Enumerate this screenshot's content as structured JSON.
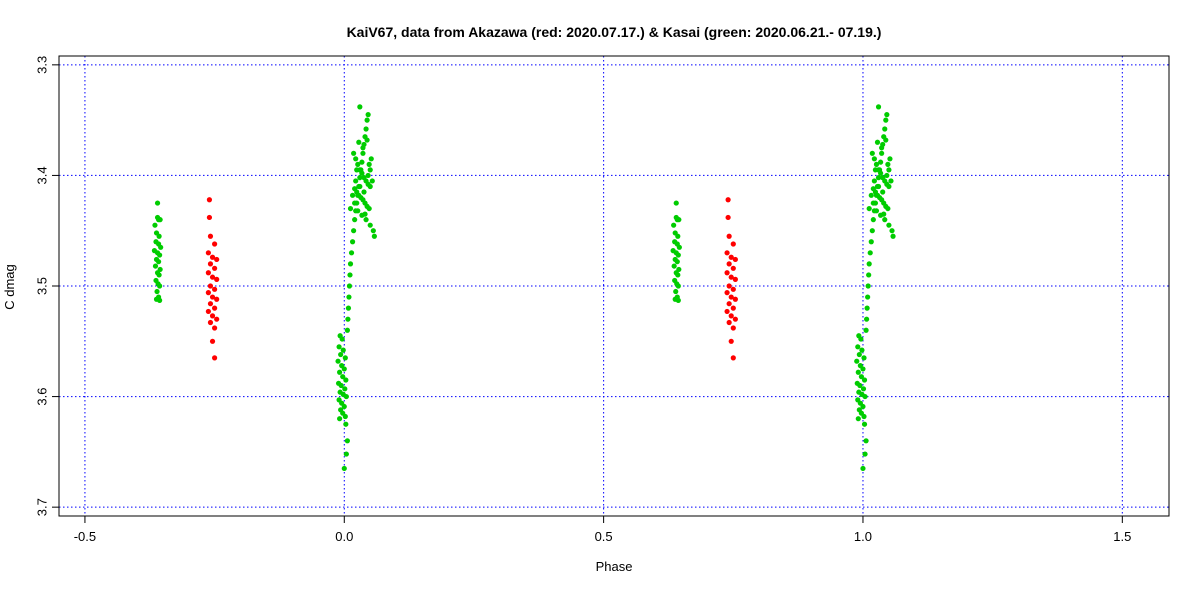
{
  "chart_data": {
    "type": "scatter",
    "title": "KaiV67, data from Akazawa (red: 2020.07.17.) &  Kasai (green: 2020.06.21.- 07.19.)",
    "xlabel": "Phase",
    "ylabel": "C dmag",
    "xlim": [
      -0.55,
      1.59
    ],
    "ylim": [
      3.708,
      3.292
    ],
    "y_inverted": true,
    "grid": true,
    "grid_color": "#0000ff",
    "legend": "none",
    "x_ticks": [
      {
        "value": -0.5,
        "label": "-0.5"
      },
      {
        "value": 0.0,
        "label": "0.0"
      },
      {
        "value": 0.5,
        "label": "0.5"
      },
      {
        "value": 1.0,
        "label": "1.0"
      },
      {
        "value": 1.5,
        "label": "1.5"
      }
    ],
    "y_ticks": [
      {
        "value": 3.3,
        "label": "3.3"
      },
      {
        "value": 3.4,
        "label": "3.4"
      },
      {
        "value": 3.5,
        "label": "3.5"
      },
      {
        "value": 3.6,
        "label": "3.6"
      },
      {
        "value": 3.7,
        "label": "3.7"
      }
    ],
    "series": [
      {
        "color": "#00cc00",
        "points": [
          [
            -0.36,
            3.425
          ],
          [
            -0.36,
            3.438
          ],
          [
            -0.358,
            3.44
          ],
          [
            -0.355,
            3.44
          ],
          [
            -0.365,
            3.445
          ],
          [
            -0.362,
            3.452
          ],
          [
            -0.357,
            3.455
          ],
          [
            -0.363,
            3.46
          ],
          [
            -0.358,
            3.462
          ],
          [
            -0.354,
            3.465
          ],
          [
            -0.366,
            3.468
          ],
          [
            -0.36,
            3.47
          ],
          [
            -0.356,
            3.472
          ],
          [
            -0.362,
            3.476
          ],
          [
            -0.358,
            3.478
          ],
          [
            -0.364,
            3.482
          ],
          [
            -0.355,
            3.485
          ],
          [
            -0.36,
            3.488
          ],
          [
            -0.357,
            3.49
          ],
          [
            -0.363,
            3.495
          ],
          [
            -0.359,
            3.498
          ],
          [
            -0.356,
            3.5
          ],
          [
            -0.361,
            3.505
          ],
          [
            -0.358,
            3.51
          ],
          [
            -0.362,
            3.512
          ],
          [
            -0.356,
            3.513
          ],
          [
            -0.008,
            3.545
          ],
          [
            -0.004,
            3.548
          ],
          [
            -0.01,
            3.555
          ],
          [
            -0.002,
            3.558
          ],
          [
            -0.007,
            3.562
          ],
          [
            0.002,
            3.565
          ],
          [
            -0.012,
            3.568
          ],
          [
            -0.005,
            3.572
          ],
          [
            0.0,
            3.575
          ],
          [
            -0.009,
            3.578
          ],
          [
            -0.003,
            3.582
          ],
          [
            0.003,
            3.585
          ],
          [
            -0.011,
            3.588
          ],
          [
            -0.006,
            3.59
          ],
          [
            0.001,
            3.593
          ],
          [
            -0.008,
            3.596
          ],
          [
            -0.002,
            3.598
          ],
          [
            0.004,
            3.6
          ],
          [
            -0.01,
            3.603
          ],
          [
            -0.005,
            3.606
          ],
          [
            0.0,
            3.609
          ],
          [
            -0.007,
            3.612
          ],
          [
            -0.003,
            3.615
          ],
          [
            0.002,
            3.618
          ],
          [
            -0.009,
            3.62
          ],
          [
            0.003,
            3.625
          ],
          [
            0.006,
            3.64
          ],
          [
            0.004,
            3.652
          ],
          [
            0.0,
            3.665
          ],
          [
            0.006,
            3.54
          ],
          [
            0.007,
            3.53
          ],
          [
            0.008,
            3.52
          ],
          [
            0.009,
            3.51
          ],
          [
            0.01,
            3.5
          ],
          [
            0.011,
            3.49
          ],
          [
            0.012,
            3.48
          ],
          [
            0.014,
            3.47
          ],
          [
            0.016,
            3.46
          ],
          [
            0.018,
            3.45
          ],
          [
            0.02,
            3.44
          ],
          [
            0.022,
            3.432
          ],
          [
            0.024,
            3.425
          ],
          [
            0.026,
            3.418
          ],
          [
            0.028,
            3.41
          ],
          [
            0.03,
            3.402
          ],
          [
            0.032,
            3.395
          ],
          [
            0.034,
            3.388
          ],
          [
            0.036,
            3.38
          ],
          [
            0.038,
            3.372
          ],
          [
            0.04,
            3.365
          ],
          [
            0.042,
            3.358
          ],
          [
            0.044,
            3.35
          ],
          [
            0.046,
            3.345
          ],
          [
            0.03,
            3.338
          ],
          [
            0.018,
            3.38
          ],
          [
            0.022,
            3.385
          ],
          [
            0.026,
            3.39
          ],
          [
            0.03,
            3.395
          ],
          [
            0.034,
            3.398
          ],
          [
            0.038,
            3.402
          ],
          [
            0.042,
            3.405
          ],
          [
            0.046,
            3.408
          ],
          [
            0.05,
            3.41
          ],
          [
            0.02,
            3.412
          ],
          [
            0.024,
            3.415
          ],
          [
            0.028,
            3.418
          ],
          [
            0.032,
            3.42
          ],
          [
            0.036,
            3.422
          ],
          [
            0.04,
            3.425
          ],
          [
            0.044,
            3.428
          ],
          [
            0.048,
            3.43
          ],
          [
            0.022,
            3.405
          ],
          [
            0.03,
            3.41
          ],
          [
            0.038,
            3.415
          ],
          [
            0.046,
            3.4
          ],
          [
            0.05,
            3.395
          ],
          [
            0.054,
            3.405
          ],
          [
            0.026,
            3.432
          ],
          [
            0.034,
            3.436
          ],
          [
            0.042,
            3.44
          ],
          [
            0.05,
            3.445
          ],
          [
            0.056,
            3.45
          ],
          [
            0.058,
            3.455
          ],
          [
            0.028,
            3.37
          ],
          [
            0.036,
            3.375
          ],
          [
            0.044,
            3.368
          ],
          [
            0.052,
            3.385
          ],
          [
            0.048,
            3.39
          ],
          [
            0.024,
            3.395
          ],
          [
            0.016,
            3.418
          ],
          [
            0.02,
            3.425
          ],
          [
            0.012,
            3.43
          ],
          [
            0.04,
            3.435
          ],
          [
            0.64,
            3.425
          ],
          [
            0.64,
            3.438
          ],
          [
            0.642,
            3.44
          ],
          [
            0.645,
            3.44
          ],
          [
            0.635,
            3.445
          ],
          [
            0.638,
            3.452
          ],
          [
            0.643,
            3.455
          ],
          [
            0.637,
            3.46
          ],
          [
            0.642,
            3.462
          ],
          [
            0.646,
            3.465
          ],
          [
            0.634,
            3.468
          ],
          [
            0.64,
            3.47
          ],
          [
            0.644,
            3.472
          ],
          [
            0.638,
            3.476
          ],
          [
            0.642,
            3.478
          ],
          [
            0.636,
            3.482
          ],
          [
            0.645,
            3.485
          ],
          [
            0.64,
            3.488
          ],
          [
            0.643,
            3.49
          ],
          [
            0.637,
            3.495
          ],
          [
            0.641,
            3.498
          ],
          [
            0.644,
            3.5
          ],
          [
            0.639,
            3.505
          ],
          [
            0.642,
            3.51
          ],
          [
            0.638,
            3.512
          ],
          [
            0.644,
            3.513
          ],
          [
            0.992,
            3.545
          ],
          [
            0.996,
            3.548
          ],
          [
            0.99,
            3.555
          ],
          [
            0.998,
            3.558
          ],
          [
            0.993,
            3.562
          ],
          [
            1.002,
            3.565
          ],
          [
            0.988,
            3.568
          ],
          [
            0.995,
            3.572
          ],
          [
            1.0,
            3.575
          ],
          [
            0.991,
            3.578
          ],
          [
            0.997,
            3.582
          ],
          [
            1.003,
            3.585
          ],
          [
            0.989,
            3.588
          ],
          [
            0.994,
            3.59
          ],
          [
            1.001,
            3.593
          ],
          [
            0.992,
            3.596
          ],
          [
            0.998,
            3.598
          ],
          [
            1.004,
            3.6
          ],
          [
            0.99,
            3.603
          ],
          [
            0.995,
            3.606
          ],
          [
            1.0,
            3.609
          ],
          [
            0.993,
            3.612
          ],
          [
            0.997,
            3.615
          ],
          [
            1.002,
            3.618
          ],
          [
            0.991,
            3.62
          ],
          [
            1.003,
            3.625
          ],
          [
            1.006,
            3.64
          ],
          [
            1.004,
            3.652
          ],
          [
            1.0,
            3.665
          ],
          [
            1.006,
            3.54
          ],
          [
            1.007,
            3.53
          ],
          [
            1.008,
            3.52
          ],
          [
            1.009,
            3.51
          ],
          [
            1.01,
            3.5
          ],
          [
            1.011,
            3.49
          ],
          [
            1.012,
            3.48
          ],
          [
            1.014,
            3.47
          ],
          [
            1.016,
            3.46
          ],
          [
            1.018,
            3.45
          ],
          [
            1.02,
            3.44
          ],
          [
            1.022,
            3.432
          ],
          [
            1.024,
            3.425
          ],
          [
            1.026,
            3.418
          ],
          [
            1.028,
            3.41
          ],
          [
            1.03,
            3.402
          ],
          [
            1.032,
            3.395
          ],
          [
            1.034,
            3.388
          ],
          [
            1.036,
            3.38
          ],
          [
            1.038,
            3.372
          ],
          [
            1.04,
            3.365
          ],
          [
            1.042,
            3.358
          ],
          [
            1.044,
            3.35
          ],
          [
            1.046,
            3.345
          ],
          [
            1.03,
            3.338
          ],
          [
            1.018,
            3.38
          ],
          [
            1.022,
            3.385
          ],
          [
            1.026,
            3.39
          ],
          [
            1.03,
            3.395
          ],
          [
            1.034,
            3.398
          ],
          [
            1.038,
            3.402
          ],
          [
            1.042,
            3.405
          ],
          [
            1.046,
            3.408
          ],
          [
            1.05,
            3.41
          ],
          [
            1.02,
            3.412
          ],
          [
            1.024,
            3.415
          ],
          [
            1.028,
            3.418
          ],
          [
            1.032,
            3.42
          ],
          [
            1.036,
            3.422
          ],
          [
            1.04,
            3.425
          ],
          [
            1.044,
            3.428
          ],
          [
            1.048,
            3.43
          ],
          [
            1.022,
            3.405
          ],
          [
            1.03,
            3.41
          ],
          [
            1.038,
            3.415
          ],
          [
            1.046,
            3.4
          ],
          [
            1.05,
            3.395
          ],
          [
            1.054,
            3.405
          ],
          [
            1.026,
            3.432
          ],
          [
            1.034,
            3.436
          ],
          [
            1.042,
            3.44
          ],
          [
            1.05,
            3.445
          ],
          [
            1.056,
            3.45
          ],
          [
            1.058,
            3.455
          ],
          [
            1.028,
            3.37
          ],
          [
            1.036,
            3.375
          ],
          [
            1.044,
            3.368
          ],
          [
            1.052,
            3.385
          ],
          [
            1.048,
            3.39
          ],
          [
            1.024,
            3.395
          ],
          [
            1.016,
            3.418
          ],
          [
            1.02,
            3.425
          ],
          [
            1.012,
            3.43
          ],
          [
            1.04,
            3.435
          ]
        ]
      },
      {
        "color": "#ff0000",
        "points": [
          [
            -0.26,
            3.422
          ],
          [
            -0.26,
            3.438
          ],
          [
            -0.258,
            3.455
          ],
          [
            -0.25,
            3.462
          ],
          [
            -0.262,
            3.47
          ],
          [
            -0.254,
            3.474
          ],
          [
            -0.246,
            3.476
          ],
          [
            -0.258,
            3.48
          ],
          [
            -0.25,
            3.484
          ],
          [
            -0.262,
            3.488
          ],
          [
            -0.254,
            3.492
          ],
          [
            -0.246,
            3.494
          ],
          [
            -0.258,
            3.5
          ],
          [
            -0.25,
            3.503
          ],
          [
            -0.262,
            3.506
          ],
          [
            -0.254,
            3.51
          ],
          [
            -0.246,
            3.512
          ],
          [
            -0.258,
            3.516
          ],
          [
            -0.25,
            3.52
          ],
          [
            -0.262,
            3.523
          ],
          [
            -0.254,
            3.527
          ],
          [
            -0.246,
            3.53
          ],
          [
            -0.258,
            3.533
          ],
          [
            -0.25,
            3.538
          ],
          [
            -0.254,
            3.55
          ],
          [
            -0.25,
            3.565
          ],
          [
            0.74,
            3.422
          ],
          [
            0.74,
            3.438
          ],
          [
            0.742,
            3.455
          ],
          [
            0.75,
            3.462
          ],
          [
            0.738,
            3.47
          ],
          [
            0.746,
            3.474
          ],
          [
            0.754,
            3.476
          ],
          [
            0.742,
            3.48
          ],
          [
            0.75,
            3.484
          ],
          [
            0.738,
            3.488
          ],
          [
            0.746,
            3.492
          ],
          [
            0.754,
            3.494
          ],
          [
            0.742,
            3.5
          ],
          [
            0.75,
            3.503
          ],
          [
            0.738,
            3.506
          ],
          [
            0.746,
            3.51
          ],
          [
            0.754,
            3.512
          ],
          [
            0.742,
            3.516
          ],
          [
            0.75,
            3.52
          ],
          [
            0.738,
            3.523
          ],
          [
            0.746,
            3.527
          ],
          [
            0.754,
            3.53
          ],
          [
            0.742,
            3.533
          ],
          [
            0.75,
            3.538
          ],
          [
            0.746,
            3.55
          ],
          [
            0.75,
            3.565
          ]
        ]
      }
    ]
  }
}
